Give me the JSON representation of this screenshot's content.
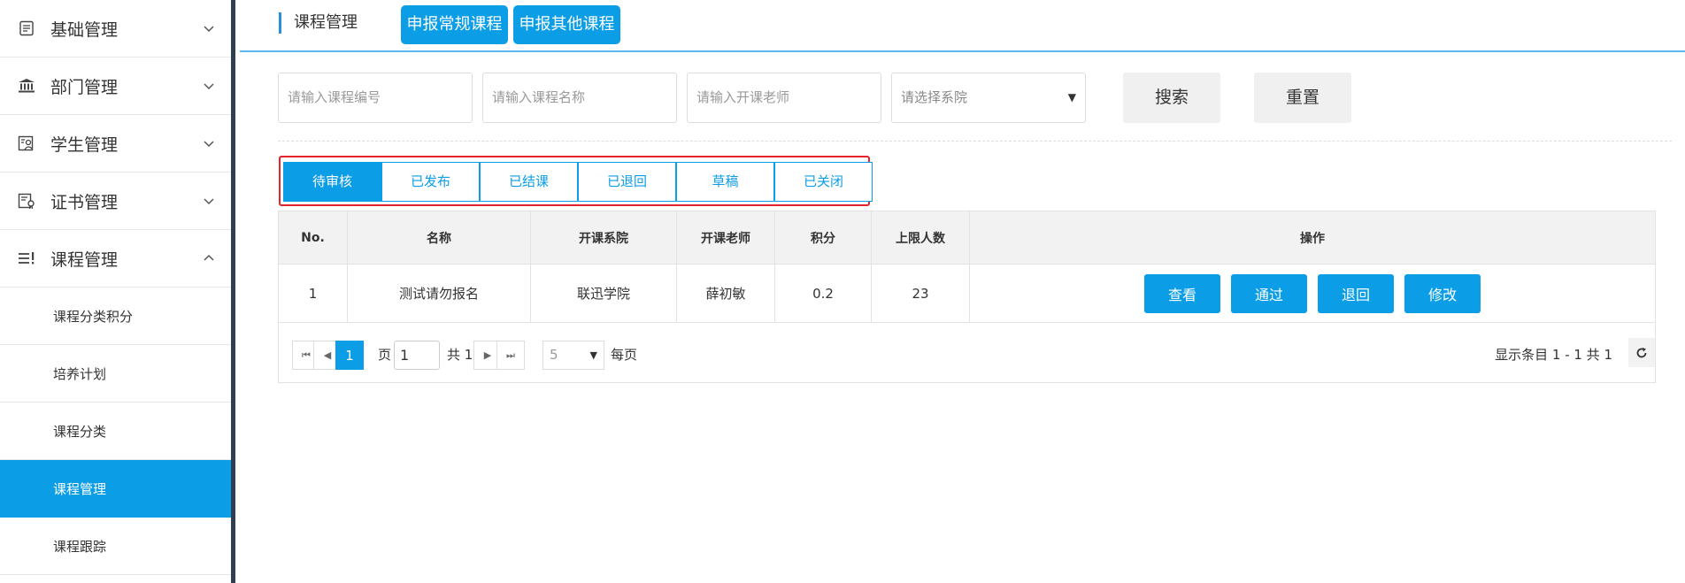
{
  "sidebar": {
    "menus": [
      {
        "label": "基础管理",
        "icon": "list-doc-icon",
        "expanded": false
      },
      {
        "label": "部门管理",
        "icon": "bank-icon",
        "expanded": false
      },
      {
        "label": "学生管理",
        "icon": "student-card-icon",
        "expanded": false
      },
      {
        "label": "证书管理",
        "icon": "certificate-icon",
        "expanded": false
      },
      {
        "label": "课程管理",
        "icon": "course-list-icon",
        "expanded": true
      }
    ],
    "sub_items": [
      {
        "label": "课程分类积分",
        "active": false
      },
      {
        "label": "培养计划",
        "active": false
      },
      {
        "label": "课程分类",
        "active": false
      },
      {
        "label": "课程管理",
        "active": true
      },
      {
        "label": "课程跟踪",
        "active": false
      }
    ]
  },
  "header": {
    "breadcrumb": "课程管理",
    "btn_regular": "申报常规课程",
    "btn_other": "申报其他课程"
  },
  "filters": {
    "code_placeholder": "请输入课程编号",
    "name_placeholder": "请输入课程名称",
    "teacher_placeholder": "请输入开课老师",
    "college_placeholder": "请选择系院",
    "search_label": "搜索",
    "reset_label": "重置"
  },
  "tabs": [
    {
      "label": "待审核",
      "active": true
    },
    {
      "label": "已发布",
      "active": false
    },
    {
      "label": "已结课",
      "active": false
    },
    {
      "label": "已退回",
      "active": false
    },
    {
      "label": "草稿",
      "active": false
    },
    {
      "label": "已关闭",
      "active": false
    }
  ],
  "table": {
    "headers": [
      "No.",
      "名称",
      "开课系院",
      "开课老师",
      "积分",
      "上限人数",
      "操作"
    ],
    "rows": [
      {
        "no": "1",
        "name": "测试请勿报名",
        "college": "联迅学院",
        "teacher": "薛初敏",
        "credit": "0.2",
        "limit": "23"
      }
    ],
    "actions": [
      "查看",
      "通过",
      "退回",
      "修改"
    ]
  },
  "pager": {
    "current_page": "1",
    "page_label": "页",
    "page_input": "1",
    "total_label": "共 1",
    "page_size": "5",
    "per_page_label": "每页",
    "summary": "显示条目 1 - 1 共 1"
  },
  "colors": {
    "accent": "#0b9de6",
    "highlight_border": "#e5232b",
    "sidebar_edge": "#2e3f52"
  }
}
